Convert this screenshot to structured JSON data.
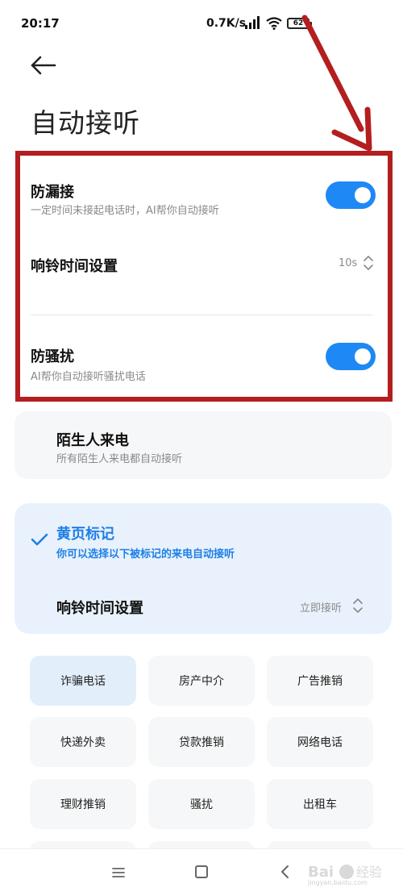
{
  "status_bar": {
    "time": "20:17",
    "net_speed": "0.7K/s",
    "battery": "62"
  },
  "header": {
    "title": "自动接听"
  },
  "missed_call": {
    "title": "防漏接",
    "subtitle": "一定时间未接起电话时，AI帮你自动接听",
    "enabled": true
  },
  "ring_time_1": {
    "title": "响铃时间设置",
    "value": "10s"
  },
  "anti_harass": {
    "title": "防骚扰",
    "subtitle": "AI帮你自动接听骚扰电话",
    "enabled": true
  },
  "stranger": {
    "title": "陌生人来电",
    "subtitle": "所有陌生人来电都自动接听"
  },
  "yellow_pages": {
    "title": "黄页标记",
    "subtitle": "你可以选择以下被标记的来电自动接听",
    "checked": true
  },
  "ring_time_2": {
    "title": "响铃时间设置",
    "value": "立即接听"
  },
  "categories": [
    {
      "label": "诈骗电话",
      "selected": true
    },
    {
      "label": "房产中介",
      "selected": false
    },
    {
      "label": "广告推销",
      "selected": false
    },
    {
      "label": "快递外卖",
      "selected": false
    },
    {
      "label": "贷款推销",
      "selected": false
    },
    {
      "label": "网络电话",
      "selected": false
    },
    {
      "label": "理财推销",
      "selected": false
    },
    {
      "label": "骚扰",
      "selected": false
    },
    {
      "label": "出租车",
      "selected": false
    }
  ],
  "watermark": {
    "text": "jingyan.baidu.com"
  },
  "colors": {
    "accent": "#1e88f5",
    "annotation_red": "#b41e1e",
    "yellow_card_bg": "#e9f2fc"
  }
}
